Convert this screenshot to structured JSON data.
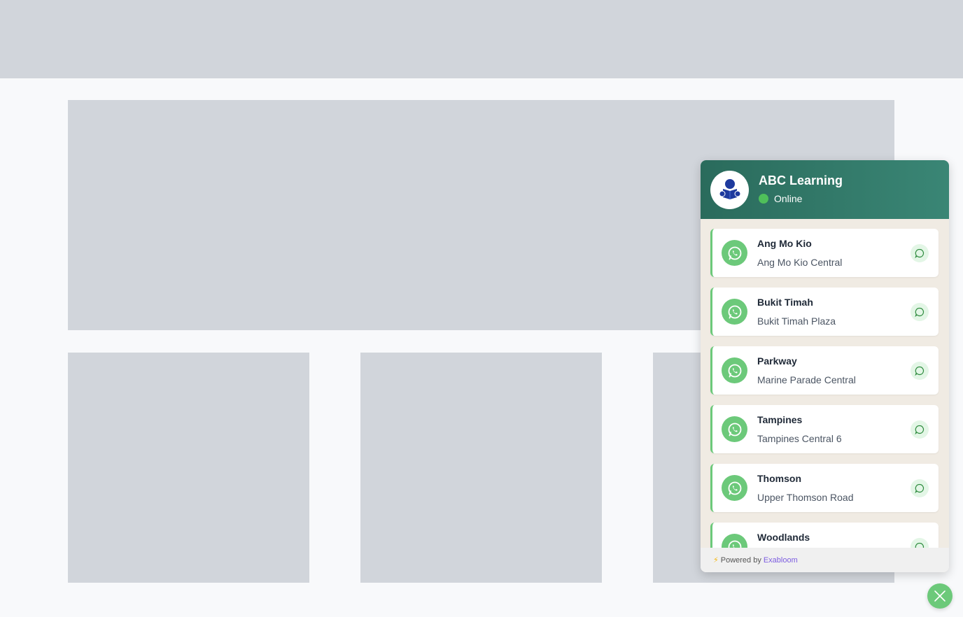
{
  "widget": {
    "title": "ABC Learning",
    "status": "Online",
    "agents": [
      {
        "name": "Ang Mo Kio",
        "location": "Ang Mo Kio Central"
      },
      {
        "name": "Bukit Timah",
        "location": "Bukit Timah Plaza"
      },
      {
        "name": "Parkway",
        "location": "Marine Parade Central"
      },
      {
        "name": "Tampines",
        "location": "Tampines Central 6"
      },
      {
        "name": "Thomson",
        "location": "Upper Thomson Road"
      },
      {
        "name": "Woodlands",
        "location": ""
      }
    ],
    "footer": {
      "powered_by": "Powered by",
      "brand": "Exabloom"
    }
  },
  "colors": {
    "header_start": "#2a6b5c",
    "header_end": "#3a8675",
    "whatsapp_green": "#6cc97a",
    "status_dot": "#4fbf5a",
    "brand_purple": "#7c5ce0",
    "placeholder_gray": "#d1d5db"
  },
  "icons": {
    "avatar": "reading-person-logo-icon",
    "agent": "whatsapp-icon",
    "chat": "chat-bubble-icon",
    "footer": "lightning-bolt-icon",
    "fab": "close-icon"
  }
}
